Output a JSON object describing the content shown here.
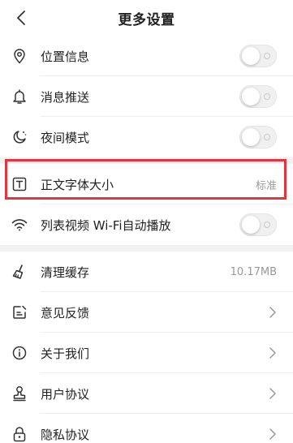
{
  "header": {
    "title": "更多设置"
  },
  "settings": {
    "location": {
      "label": "位置信息",
      "icon": "location-pin-icon",
      "enabled": false
    },
    "push": {
      "label": "消息推送",
      "icon": "bell-icon",
      "enabled": false
    },
    "night": {
      "label": "夜间模式",
      "icon": "moon-icon",
      "enabled": false
    },
    "font_size": {
      "label": "正文字体大小",
      "value": "标准",
      "icon": "text-size-icon"
    },
    "wifi_autoplay": {
      "label": "列表视频 Wi-Fi自动播放",
      "icon": "wifi-icon",
      "enabled": false
    },
    "clear_cache": {
      "label": "清理缓存",
      "value": "10.17MB",
      "icon": "broom-icon"
    },
    "feedback": {
      "label": "意见反馈",
      "icon": "edit-icon"
    },
    "about": {
      "label": "关于我们",
      "icon": "info-icon"
    },
    "user_agreement": {
      "label": "用户协议",
      "icon": "stamp-icon"
    },
    "privacy": {
      "label": "隐私协议",
      "icon": "lock-icon"
    }
  },
  "colors": {
    "highlight": "#e8333d",
    "background": "#f2f2f2",
    "text": "#222222",
    "muted": "#999999"
  }
}
